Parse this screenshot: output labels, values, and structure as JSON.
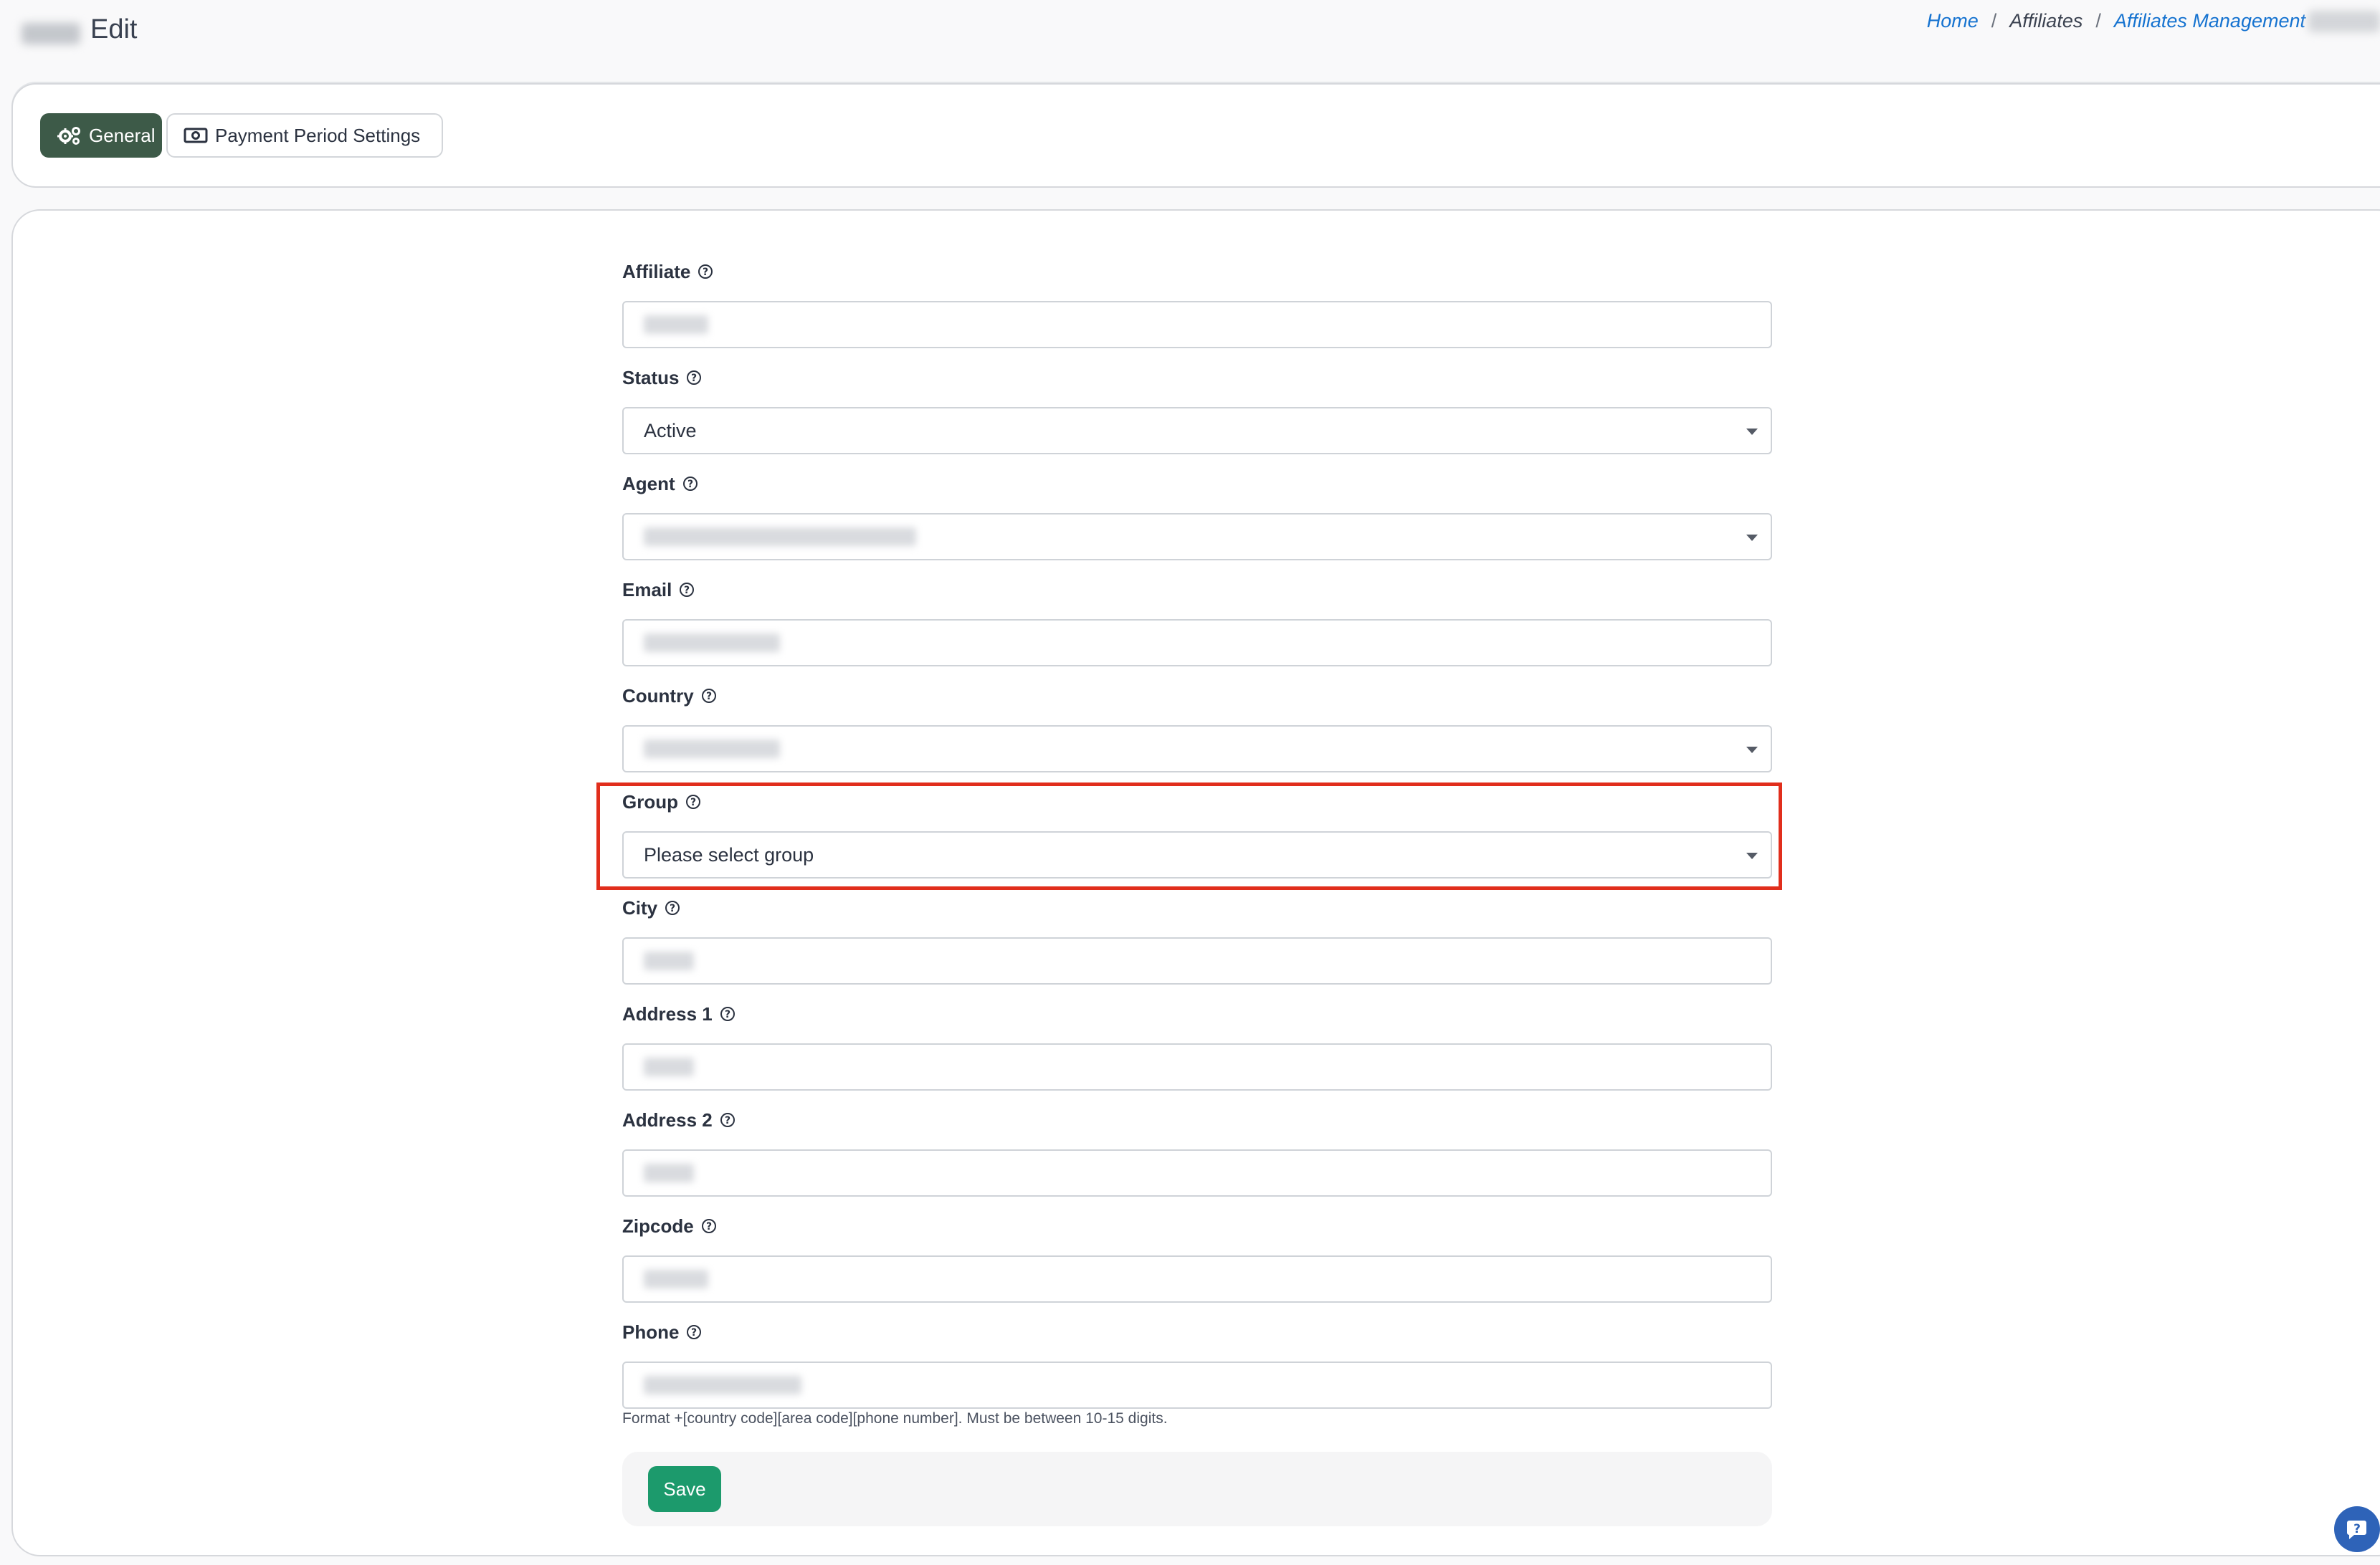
{
  "header": {
    "title": "Edit",
    "breadcrumb": [
      {
        "label": "Home",
        "link": true
      },
      {
        "label": "Affiliates",
        "link": false
      },
      {
        "label": "Affiliates Management",
        "link": true
      }
    ]
  },
  "tabs": [
    {
      "label": "General",
      "icon": "gears-icon",
      "active": true
    },
    {
      "label": "Payment Period Settings",
      "icon": "money-bill-icon",
      "active": false
    }
  ],
  "form": {
    "fields": [
      {
        "label": "Affiliate",
        "type": "text",
        "value": ""
      },
      {
        "label": "Status",
        "type": "select",
        "value": "Active"
      },
      {
        "label": "Agent",
        "type": "select",
        "value": ""
      },
      {
        "label": "Email",
        "type": "text",
        "value": ""
      },
      {
        "label": "Country",
        "type": "select",
        "value": ""
      },
      {
        "label": "Group",
        "type": "select",
        "placeholder": "Please select group"
      },
      {
        "label": "City",
        "type": "text",
        "value": ""
      },
      {
        "label": "Address 1",
        "type": "text",
        "value": ""
      },
      {
        "label": "Address 2",
        "type": "text",
        "value": ""
      },
      {
        "label": "Zipcode",
        "type": "text",
        "value": ""
      },
      {
        "label": "Phone",
        "type": "text",
        "value": ""
      }
    ],
    "phone_help": "Format +[country code][area code][phone number]. Must be between 10-15 digits.",
    "save_label": "Save"
  },
  "colors": {
    "active_tab": "#3d5a48",
    "save_button": "#1c9a6c",
    "highlight_border": "#e12e1c",
    "link": "#1673d0"
  },
  "icons": {
    "help": "question-circle-icon",
    "dropdown": "caret-down-icon",
    "chat": "help-chat-icon"
  }
}
